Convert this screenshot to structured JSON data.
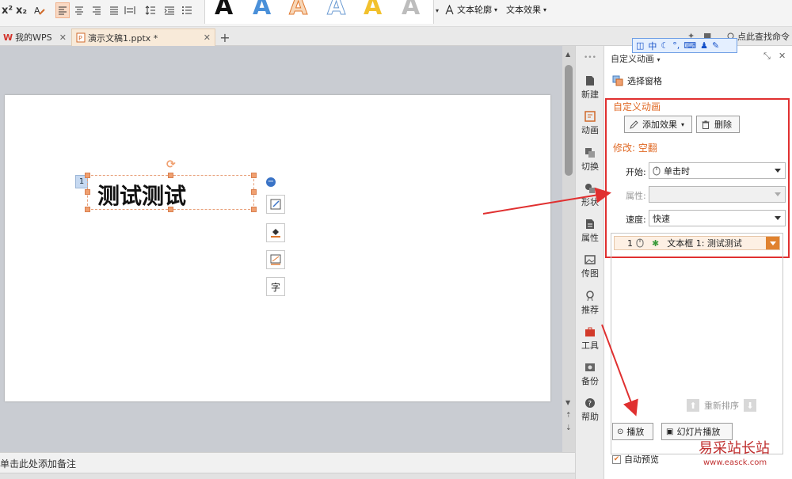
{
  "ribbon": {
    "superscript": "x²",
    "subscript": "x₂",
    "text_outline": "文本轮廓",
    "text_effect": "文本效果",
    "search_command": "点此查找命令",
    "wordart_letter": "A"
  },
  "tabs": [
    {
      "label": "我的WPS"
    },
    {
      "label": "演示文稿1.pptx *"
    }
  ],
  "slide": {
    "animation_number": "1",
    "textbox_text": "测试测试"
  },
  "notes": {
    "placeholder": "单击此处添加备注"
  },
  "sidebar": {
    "items": [
      {
        "label": "新建",
        "icon": "document-icon"
      },
      {
        "label": "动画",
        "icon": "animation-icon"
      },
      {
        "label": "切换",
        "icon": "transition-icon"
      },
      {
        "label": "形状",
        "icon": "shape-icon"
      },
      {
        "label": "属性",
        "icon": "properties-icon"
      },
      {
        "label": "传图",
        "icon": "image-icon"
      },
      {
        "label": "推荐",
        "icon": "recommend-icon"
      },
      {
        "label": "工具",
        "icon": "toolbox-icon"
      },
      {
        "label": "备份",
        "icon": "backup-icon"
      },
      {
        "label": "帮助",
        "icon": "help-icon"
      }
    ]
  },
  "pane": {
    "title": "自定义动画",
    "select_pane": "选择窗格",
    "section_title": "自定义动画",
    "add_effect": "添加效果",
    "delete": "删除",
    "modify": "修改: 空翻",
    "start_label": "开始:",
    "start_value": "单击时",
    "property_label": "属性:",
    "speed_label": "速度:",
    "speed_value": "快速",
    "item_index": "1",
    "item_text": "文本框 1: 测试测试",
    "reorder": "重新排序",
    "play": "播放",
    "slideshow": "幻灯片播放",
    "auto_preview": "自动预览"
  },
  "ime": {
    "lang": "中"
  },
  "watermark": {
    "cn": "易采站长站",
    "url": "www.easck.com"
  }
}
